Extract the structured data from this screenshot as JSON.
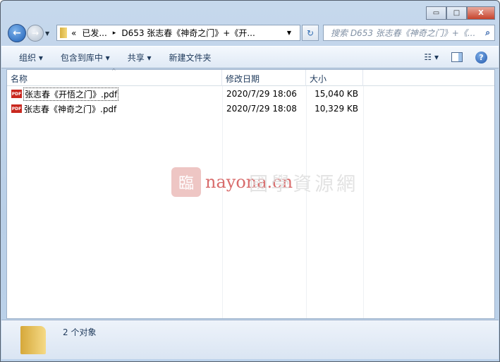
{
  "window": {
    "minimize": "▭",
    "maximize": "□",
    "close": "X"
  },
  "nav": {
    "back_icon": "←",
    "forward_icon": "→",
    "dropdown": "▼"
  },
  "address": {
    "segments": [
      "«",
      "已发...",
      "▸",
      "D653 张志春《神奇之门》+《开..."
    ],
    "dropdown": "▼",
    "refresh_icon": "↻"
  },
  "search": {
    "placeholder": "搜索 D653 张志春《神奇之门》+《...",
    "icon": "⌕"
  },
  "toolbar": {
    "organize": "组织 ▾",
    "include_library": "包含到库中 ▾",
    "share": "共享 ▾",
    "new_folder": "新建文件夹",
    "views": "☷ ▾",
    "help": "?"
  },
  "columns": {
    "name": "名称",
    "modified": "修改日期",
    "size": "大小",
    "sort_indicator": "^"
  },
  "files": [
    {
      "icon": "PDF",
      "name": "张志春《开悟之门》.pdf",
      "modified": "2020/7/29 18:06",
      "size": "15,040 KB"
    },
    {
      "icon": "PDF",
      "name": "张志春《神奇之门》.pdf",
      "modified": "2020/7/29 18:08",
      "size": "10,329 KB"
    }
  ],
  "watermark": {
    "logo": "臨",
    "url": "nayona.cn",
    "text": "國學資源網"
  },
  "status": {
    "count": "2 个对象"
  }
}
